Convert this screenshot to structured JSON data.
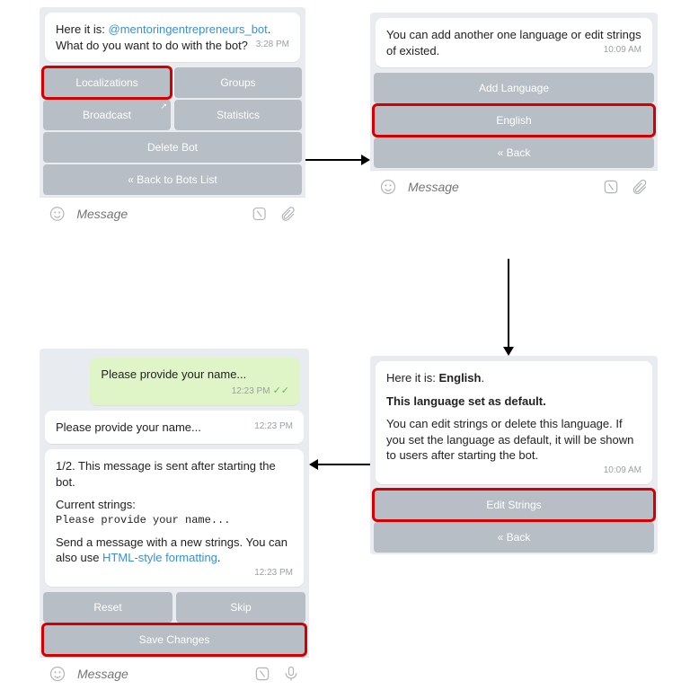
{
  "panel1": {
    "msg_prefix": "Here it is: ",
    "bot_handle": "@mentoringentrepreneurs_bot",
    "msg_suffix": ". What do you want to do with the bot?",
    "time": "3:28 PM",
    "btn_localizations": "Localizations",
    "btn_groups": "Groups",
    "btn_broadcast": "Broadcast",
    "btn_statistics": "Statistics",
    "btn_delete": "Delete Bot",
    "btn_back": "« Back to Bots List",
    "input_placeholder": "Message"
  },
  "panel2": {
    "msg": "You can add another one language or edit strings of existed.",
    "time": "10:09 AM",
    "btn_add": "Add Language",
    "btn_english": "English",
    "btn_back": "« Back",
    "input_placeholder": "Message"
  },
  "panel3": {
    "line1_prefix": "Here it is: ",
    "line1_lang": "English",
    "line1_suffix": ".",
    "line2": "This language set as default.",
    "line3": "You can edit strings or delete this language. If you set the language as default, it will be shown to users after starting the bot.",
    "time": "10:09 AM",
    "btn_edit": "Edit Strings",
    "btn_back": "« Back"
  },
  "panel4": {
    "out_msg": "Please provide your name...",
    "out_time": "12:23 PM",
    "echo_msg": "Please provide your name...",
    "echo_time": "12:23 PM",
    "body_l1": "1/2. This message is sent after starting the bot.",
    "body_l2": "Current strings:",
    "body_l3": "Please provide your name...",
    "body_l4": "Send a message with a new strings. You can also use ",
    "body_link": "HTML-style formatting",
    "body_l4b": ".",
    "body_time": "12:23 PM",
    "btn_reset": "Reset",
    "btn_skip": "Skip",
    "btn_save": "Save Changes",
    "input_placeholder": "Message"
  }
}
